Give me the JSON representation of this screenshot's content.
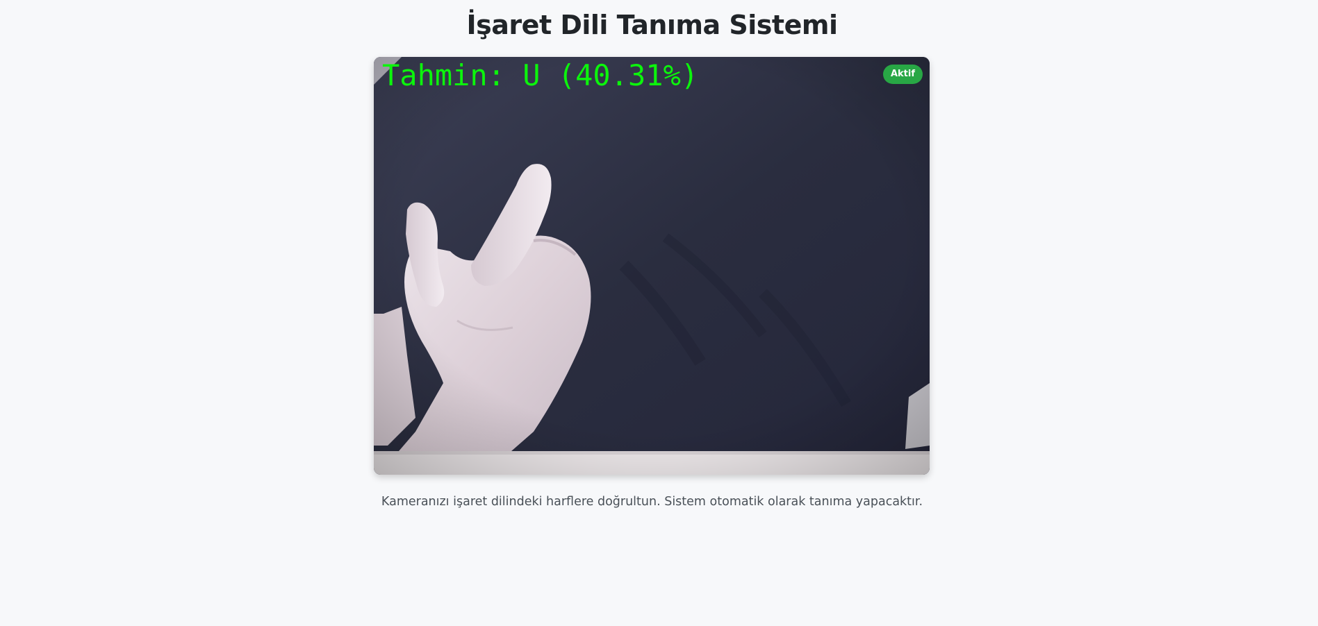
{
  "page": {
    "title": "İşaret Dili Tanıma Sistemi",
    "instructions": "Kameranızı işaret dilindeki harflere doğrultun. Sistem otomatik olarak tanıma yapacaktır."
  },
  "video": {
    "prediction_text": "Tahmin: U (40.31%)",
    "status_badge": "Aktif",
    "prediction_color": "#0cf50c",
    "status_color": "#28a745"
  }
}
